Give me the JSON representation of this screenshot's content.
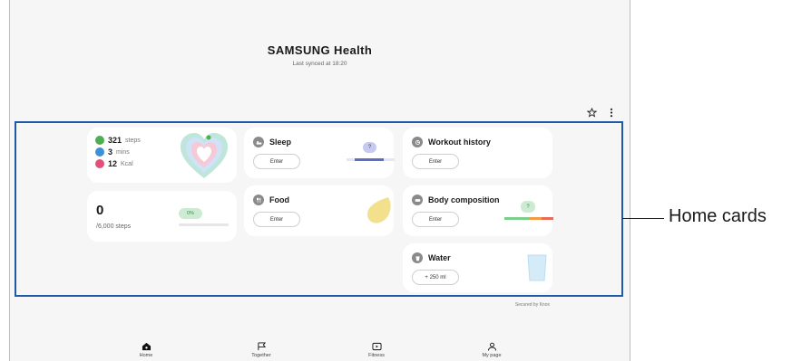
{
  "header": {
    "brand": "SAMSUNG Health",
    "synced": "Last synced at 18:20"
  },
  "top_icons": [
    "star-icon",
    "more-icon"
  ],
  "activity": {
    "steps_value": "321",
    "steps_unit": "steps",
    "mins_value": "3",
    "mins_unit": "mins",
    "kcal_value": "12",
    "kcal_unit": "Kcal",
    "colors": {
      "steps": "#4caf50",
      "mins": "#3d8fd6",
      "kcal": "#e2507a"
    }
  },
  "steps_card": {
    "value": "0",
    "target": "/6,000 steps",
    "percent_label": "0%",
    "progress": 0
  },
  "sleep": {
    "title": "Sleep",
    "button": "Enter",
    "question": "?"
  },
  "food": {
    "title": "Food",
    "button": "Enter"
  },
  "workout": {
    "title": "Workout history",
    "button": "Enter"
  },
  "body": {
    "title": "Body composition",
    "button": "Enter",
    "question": "?"
  },
  "water": {
    "title": "Water",
    "button": "+ 250 ml"
  },
  "footer": {
    "knox": "Secured by Knox"
  },
  "nav": {
    "home": "Home",
    "together": "Together",
    "fitness": "Fitness",
    "mypage": "My page"
  },
  "callout": {
    "label": "Home cards"
  }
}
